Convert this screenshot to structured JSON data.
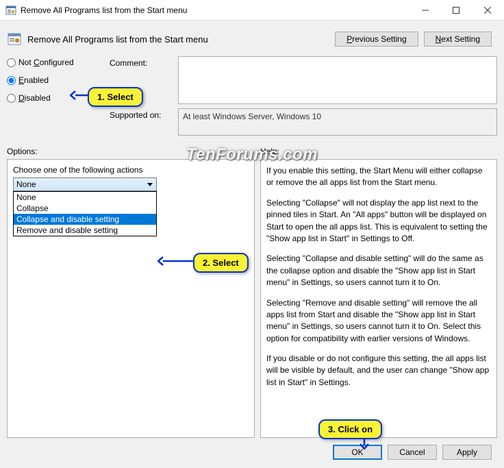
{
  "title": "Remove All Programs list from the Start menu",
  "header": {
    "policy_title": "Remove All Programs list from the Start menu",
    "prev_btn": "Previous Setting",
    "next_btn": "Next Setting"
  },
  "config": {
    "not_configured": "Not Configured",
    "enabled": "Enabled",
    "disabled": "Disabled",
    "comment_label": "Comment:",
    "comment_value": "",
    "supported_label": "Supported on:",
    "supported_value": "At least Windows Server, Windows 10"
  },
  "labels": {
    "options": "Options:",
    "help": "Help:"
  },
  "options": {
    "choose_label": "Choose one of the following actions",
    "selected": "None",
    "items": [
      "None",
      "Collapse",
      "Collapse and disable setting",
      "Remove and disable setting"
    ]
  },
  "help": {
    "p1": "If you enable this setting, the Start Menu will either collapse or remove the all apps list from the Start menu.",
    "p2": "Selecting \"Collapse\" will not display the app list next to the pinned tiles in Start. An \"All apps\" button will be displayed on Start to open the all apps list. This is equivalent to setting the \"Show app list in Start\" in Settings to Off.",
    "p3": "Selecting \"Collapse and disable setting\" will do the same as the collapse option and disable the \"Show app list in Start menu\" in Settings, so users cannot turn it to On.",
    "p4": "Selecting \"Remove and disable setting\" will remove the all apps list from Start and disable the \"Show app list in Start menu\" in Settings, so users cannot turn it to On. Select this option for compatibility with earlier versions of Windows.",
    "p5": "If you disable or do not configure this setting, the all apps list will be visible by default, and the user can change \"Show app list in Start\" in Settings."
  },
  "footer": {
    "ok": "OK",
    "cancel": "Cancel",
    "apply": "Apply"
  },
  "callouts": {
    "c1": "1. Select",
    "c2": "2. Select",
    "c3": "3. Click on"
  },
  "watermark": "TenForums.com"
}
